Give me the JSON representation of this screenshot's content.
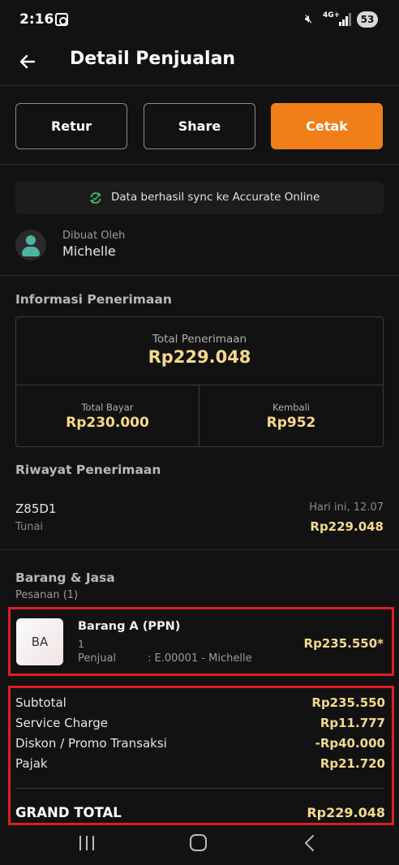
{
  "status_bar": {
    "time": "2:16",
    "network": "4G+",
    "battery": "53"
  },
  "header": {
    "title": "Detail Penjualan"
  },
  "actions": {
    "retur": "Retur",
    "share": "Share",
    "cetak": "Cetak"
  },
  "sync": {
    "message": "Data berhasil sync ke Accurate Online"
  },
  "creator": {
    "label": "Dibuat Oleh",
    "name": "Michelle"
  },
  "informasi": {
    "title": "Informasi Penerimaan",
    "total_label": "Total Penerimaan",
    "total_value": "Rp229.048",
    "bayar_label": "Total Bayar",
    "bayar_value": "Rp230.000",
    "kembali_label": "Kembali",
    "kembali_value": "Rp952"
  },
  "riwayat": {
    "title": "Riwayat Penerimaan",
    "entry": {
      "id": "Z85D1",
      "method": "Tunai",
      "time": "Hari ini, 12.07",
      "amount": "Rp229.048"
    }
  },
  "barang": {
    "title": "Barang & Jasa",
    "pesanan": "Pesanan (1)",
    "item": {
      "thumb": "BA",
      "name": "Barang A (PPN)",
      "qty": "1",
      "seller_label": "Penjual",
      "seller_value": ": E.00001 - Michelle",
      "price": "Rp235.550*"
    }
  },
  "totals": {
    "subtotal_label": "Subtotal",
    "subtotal_value": "Rp235.550",
    "service_label": "Service Charge",
    "service_value": "Rp11.777",
    "diskon_label": "Diskon / Promo Transaksi",
    "diskon_value": "-Rp40.000",
    "pajak_label": "Pajak",
    "pajak_value": "Rp21.720",
    "grand_label": "GRAND TOTAL",
    "grand_value": "Rp229.048"
  },
  "colors": {
    "accent": "#f07f1a",
    "amount": "#f5d98a",
    "highlight": "#e01c24",
    "background": "#121212"
  },
  "icons": {
    "back": "arrow-left-icon",
    "sync": "sync-icon",
    "avatar": "user-icon"
  }
}
